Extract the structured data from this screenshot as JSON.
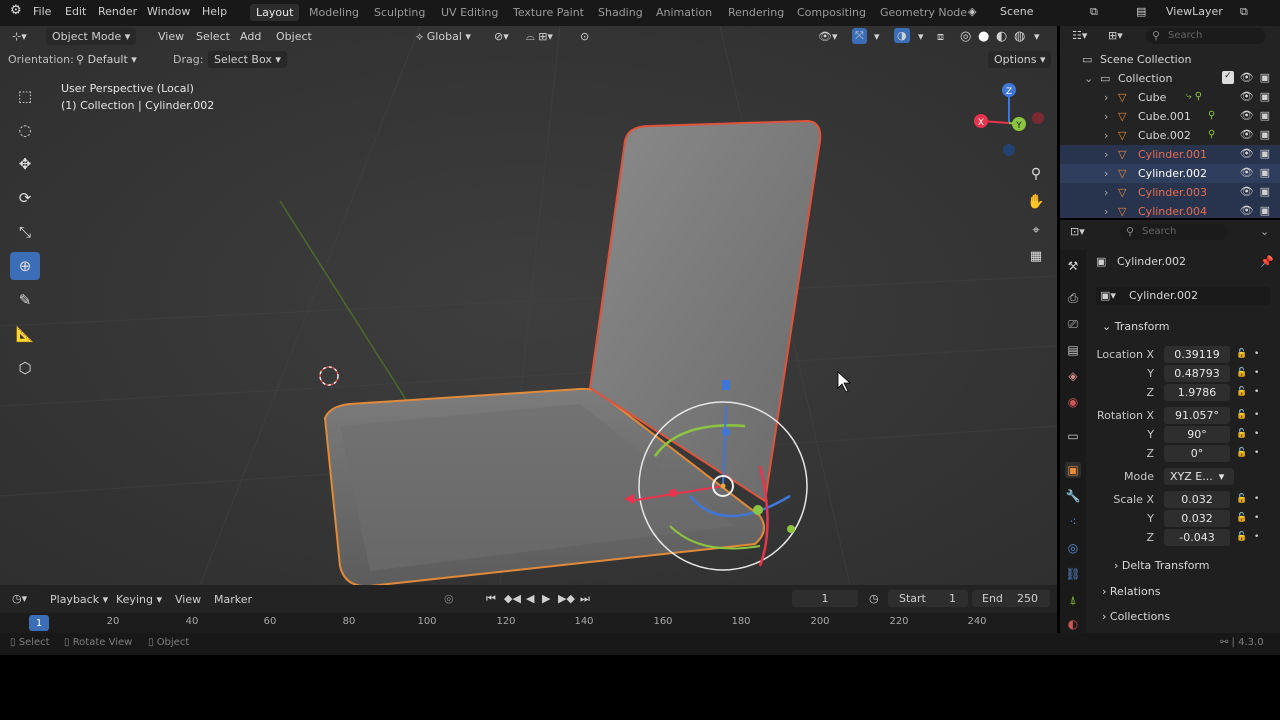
{
  "top_menu": {
    "items": [
      "File",
      "Edit",
      "Render",
      "Window",
      "Help"
    ],
    "workspaces": [
      "Layout",
      "Modeling",
      "Sculpting",
      "UV Editing",
      "Texture Paint",
      "Shading",
      "Animation",
      "Rendering",
      "Compositing",
      "Geometry Node"
    ],
    "active_workspace": "Layout",
    "scene": "Scene",
    "view_layer": "ViewLayer"
  },
  "viewport": {
    "mode": "Object Mode",
    "menus": [
      "View",
      "Select",
      "Add",
      "Object"
    ],
    "transform_orientation": "Global",
    "orientation_label": "Orientation:",
    "orientation_value": "Default",
    "drag_label": "Drag:",
    "drag_value": "Select Box",
    "options": "Options",
    "info_line1": "User Perspective (Local)",
    "info_line2": "(1) Collection | Cylinder.002"
  },
  "toolbar": {
    "tools": [
      "select-box-icon",
      "cursor-icon",
      "move-icon",
      "rotate-icon",
      "scale-icon",
      "transform-icon",
      "annotate-icon",
      "measure-icon",
      "add-cube-icon"
    ],
    "active_index": 5
  },
  "timeline": {
    "menus": [
      "Playback",
      "Keying",
      "View",
      "Marker"
    ],
    "current_frame": "1",
    "start_label": "Start",
    "start": "1",
    "end_label": "End",
    "end": "250",
    "ruler_ticks": [
      "20",
      "40",
      "60",
      "80",
      "100",
      "120",
      "140",
      "160",
      "180",
      "200",
      "220",
      "240"
    ],
    "frame_badge": "1"
  },
  "statusbar": {
    "items": [
      "Select",
      "Rotate View",
      "Object"
    ],
    "version": "4.3.0"
  },
  "outliner": {
    "search_placeholder": "Search",
    "root": "Scene Collection",
    "collection": "Collection",
    "objects": [
      {
        "name": "Cube",
        "color": "#d6d6d6"
      },
      {
        "name": "Cube.001",
        "color": "#d6d6d6"
      },
      {
        "name": "Cube.002",
        "color": "#d6d6d6"
      },
      {
        "name": "Cylinder.001",
        "color": "#e86b4f"
      },
      {
        "name": "Cylinder.002",
        "color": "#ffffff"
      },
      {
        "name": "Cylinder.003",
        "color": "#e86b4f"
      },
      {
        "name": "Cylinder.004",
        "color": "#e86b4f"
      }
    ]
  },
  "properties": {
    "search_placeholder": "Search",
    "object_name": "Cylinder.002",
    "object_field": "Cylinder.002",
    "transform_title": "Transform",
    "location_label": "Location X",
    "location": {
      "x": "0.39119",
      "y": "0.48793",
      "z": "1.9786"
    },
    "rotation_label": "Rotation X",
    "rotation": {
      "x": "91.057°",
      "y": "90°",
      "z": "0°"
    },
    "mode_label": "Mode",
    "mode_value": "XYZ E...",
    "scale_label": "Scale X",
    "scale": {
      "x": "0.032",
      "y": "0.032",
      "z": "-0.043"
    },
    "y_label": "Y",
    "z_label": "Z",
    "sections": [
      "Delta Transform",
      "Relations",
      "Collections"
    ]
  },
  "colors": {
    "accent": "#3c6db7",
    "selection_outline": "#e0533a",
    "axis_x": "#e8344d",
    "axis_y": "#8cc63f",
    "axis_z": "#3f77d8"
  }
}
